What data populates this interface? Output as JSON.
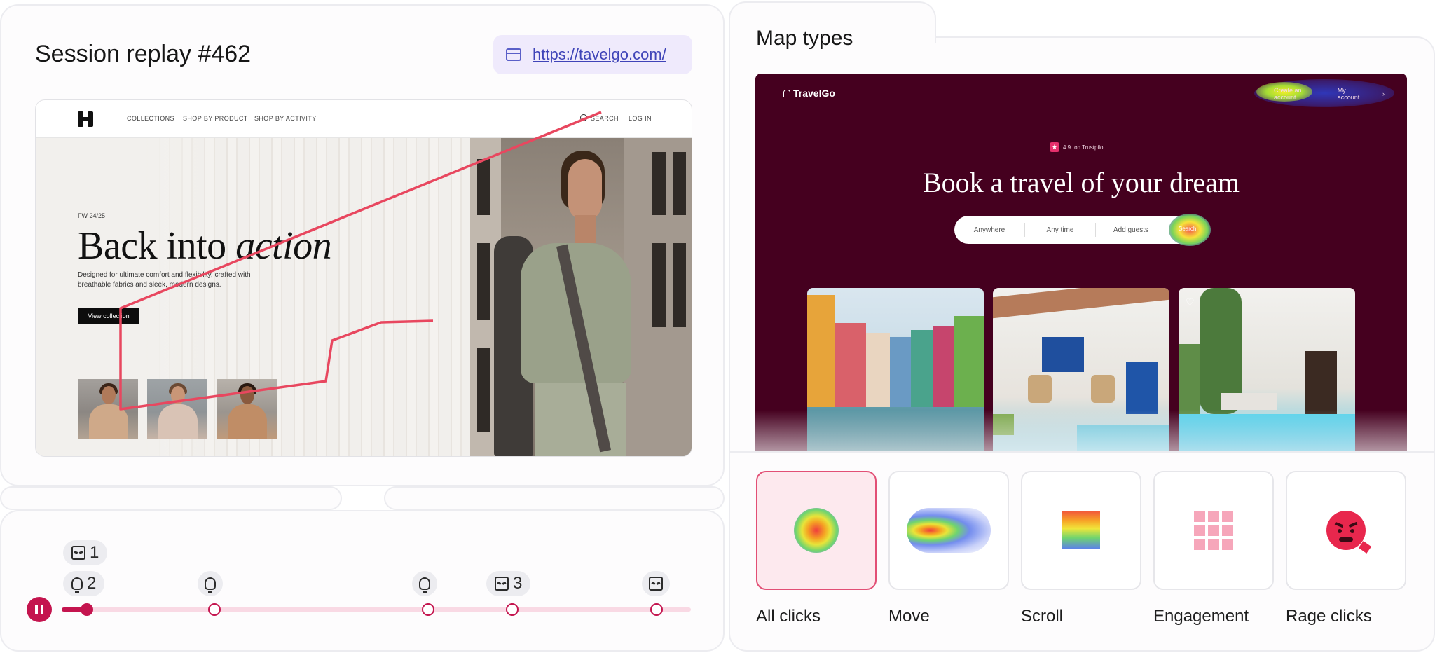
{
  "replay": {
    "title": "Session replay #462",
    "url": "https://tavelgo.com/",
    "site": {
      "nav_links": [
        "COLLECTIONS",
        "SHOP BY PRODUCT",
        "SHOP BY ACTIVITY"
      ],
      "search_label": "SEARCH",
      "login_label": "LOG IN",
      "season": "FW 24/25",
      "hero_title_plain": "Back into ",
      "hero_title_italic": "action",
      "hero_description": "Designed for ultimate comfort and flexibility, crafted with breathable fabrics and sleek, modern designs.",
      "hero_button": "View collection"
    }
  },
  "timeline": {
    "progress_fraction": 0.04,
    "markers": [
      {
        "icon": "rage-click-icon",
        "count": "1"
      },
      {
        "icon": "insight-bulb-icon",
        "count": "2"
      },
      {
        "icon": "insight-bulb-icon",
        "count": ""
      },
      {
        "icon": "insight-bulb-icon",
        "count": ""
      },
      {
        "icon": "rage-click-icon",
        "count": "3"
      },
      {
        "icon": "rage-click-icon",
        "count": ""
      }
    ],
    "accent_color": "#c4144e"
  },
  "map_types": {
    "title": "Map types",
    "preview": {
      "logo": "TravelGo",
      "nav_create_account": "Create an account",
      "nav_my_account": "My account",
      "rating": "4.9",
      "rating_source": "on Trustpilot",
      "headline": "Book a travel of your dream",
      "search_fields": [
        "Anywhere",
        "Any time",
        "Add guests"
      ],
      "search_button": "Search"
    },
    "options": [
      {
        "label": "All clicks",
        "icon": "click-heatmap-icon",
        "selected": true
      },
      {
        "label": "Move",
        "icon": "move-heatmap-icon",
        "selected": false
      },
      {
        "label": "Scroll",
        "icon": "scroll-heatmap-icon",
        "selected": false
      },
      {
        "label": "Engagement",
        "icon": "engagement-grid-icon",
        "selected": false
      },
      {
        "label": "Rage clicks",
        "icon": "angry-face-icon",
        "selected": false
      }
    ],
    "accent_color": "#e24f75",
    "preview_background": "#45001f"
  }
}
